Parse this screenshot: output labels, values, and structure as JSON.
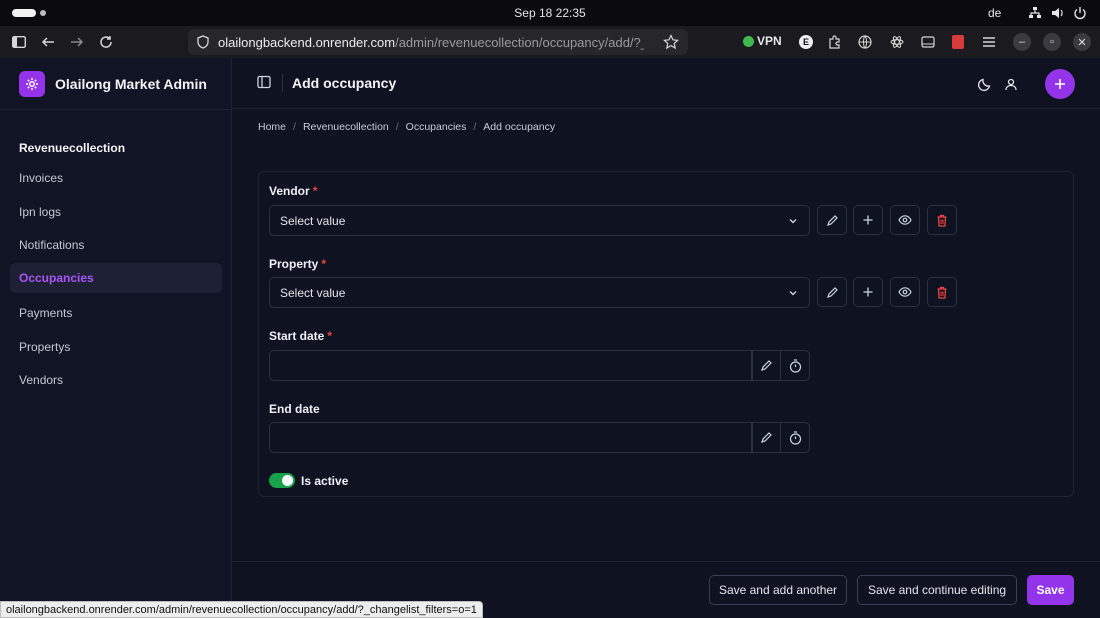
{
  "os": {
    "clock": "Sep 18  22:35",
    "language": "de",
    "icons": [
      "network-icon",
      "volume-icon",
      "power-icon"
    ]
  },
  "browser": {
    "url_host": "olailongbackend.onrender.com",
    "url_path": "/admin/revenuecollection/occupancy/add/?_changelist_filters=o=1",
    "vpn_label": "VPN",
    "status_url": "olailongbackend.onrender.com/admin/revenuecollection/occupancy/add/?_changelist_filters=o=1"
  },
  "brand": {
    "name": "Olailong Market Admin",
    "accent": "#9333ea"
  },
  "sidebar": {
    "section": "Revenuecollection",
    "items": [
      {
        "label": "Invoices",
        "active": false
      },
      {
        "label": "Ipn logs",
        "active": false
      },
      {
        "label": "Notifications",
        "active": false
      },
      {
        "label": "Occupancies",
        "active": true
      },
      {
        "label": "Payments",
        "active": false
      },
      {
        "label": "Propertys",
        "active": false
      },
      {
        "label": "Vendors",
        "active": false
      }
    ]
  },
  "header": {
    "title": "Add occupancy"
  },
  "breadcrumb": [
    "Home",
    "Revenuecollection",
    "Occupancies",
    "Add occupancy"
  ],
  "form": {
    "vendor": {
      "label": "Vendor",
      "required": "*",
      "placeholder": "Select value"
    },
    "property": {
      "label": "Property",
      "required": "*",
      "placeholder": "Select value"
    },
    "start_date": {
      "label": "Start date",
      "required": "*",
      "value": ""
    },
    "end_date": {
      "label": "End date",
      "value": ""
    },
    "is_active": {
      "label": "Is active",
      "checked": true
    }
  },
  "actions": {
    "save_add_another": "Save and add another",
    "save_continue": "Save and continue editing",
    "save": "Save"
  },
  "colors": {
    "danger": "#ef4444",
    "toggle_on": "#16a34a",
    "background": "#0f1220"
  }
}
